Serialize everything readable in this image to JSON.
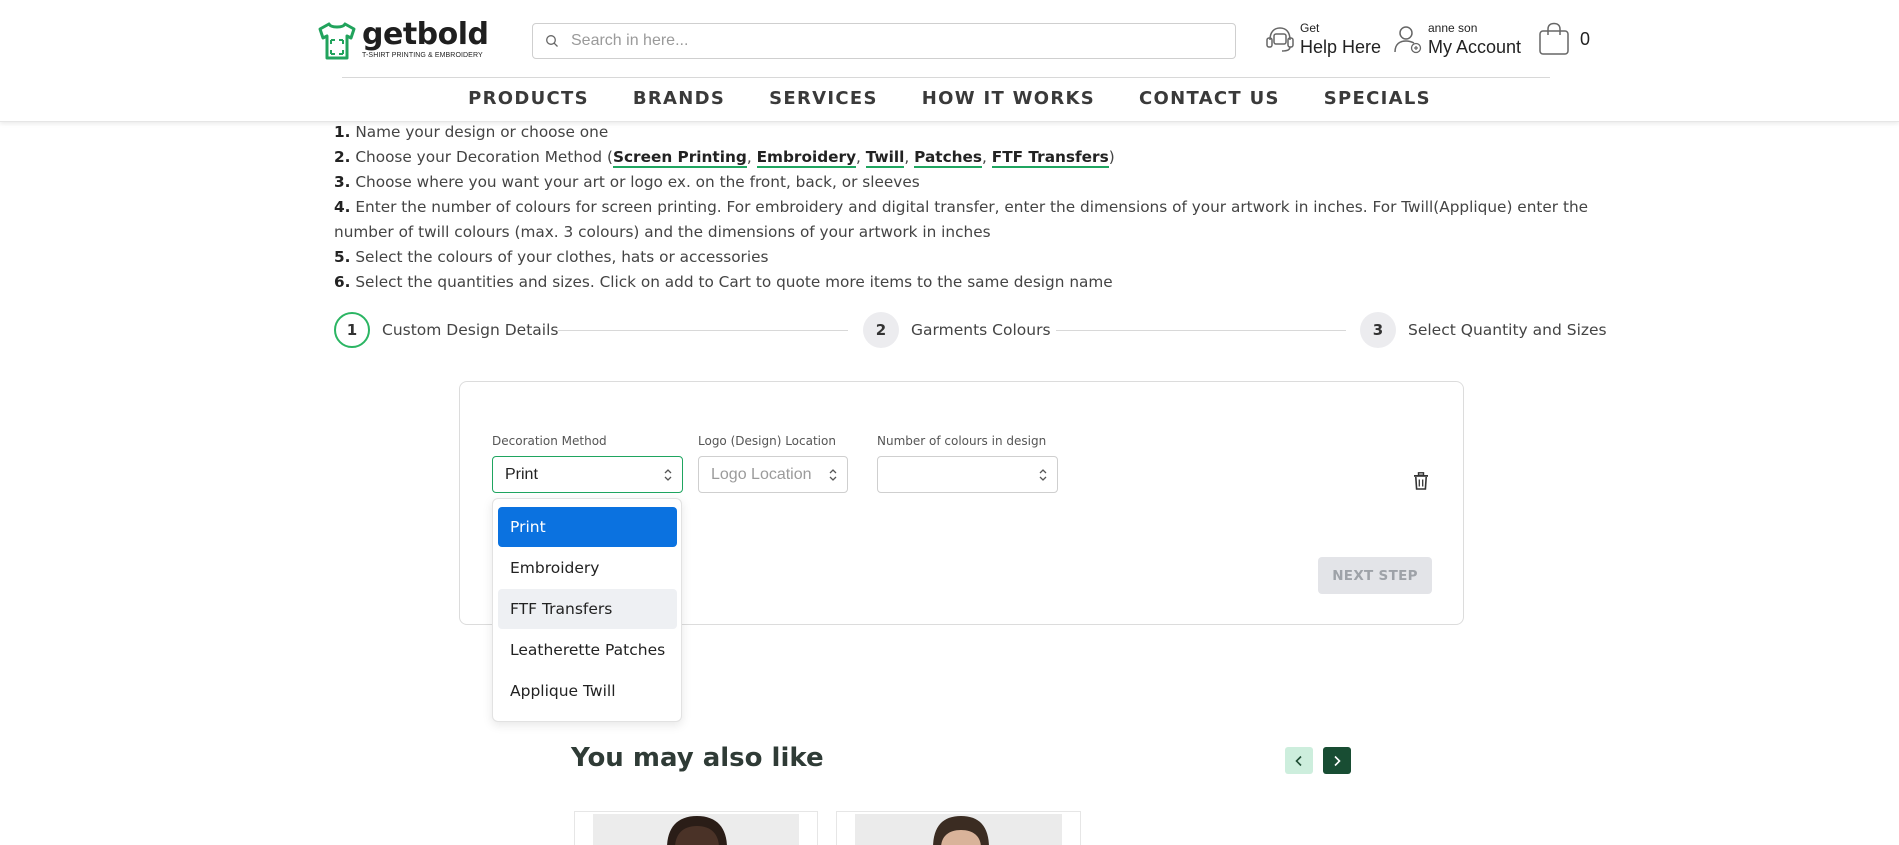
{
  "header": {
    "logo_word": "getbold",
    "logo_tagline": "T-SHIRT PRINTING & EMBROIDERY",
    "search_placeholder": "Search in here...",
    "help_small": "Get",
    "help_big": "Help Here",
    "account_small": "anne son",
    "account_big": "My Account",
    "cart_count": "0"
  },
  "nav": [
    "PRODUCTS",
    "BRANDS",
    "SERVICES",
    "HOW IT WORKS",
    "CONTACT US",
    "SPECIALS"
  ],
  "instructions": {
    "n1": "1.",
    "t1": "Name your design or choose one",
    "n2": "2.",
    "t2a": "Choose your Decoration Method (",
    "m1": "Screen Printing",
    "m2": "Embroidery",
    "m3": "Twill",
    "m4": "Patches",
    "m5": "FTF Transfers",
    "sep": ", ",
    "close": ")",
    "n3": "3.",
    "t3": "Choose where you want your art or logo ex. on the front, back, or sleeves",
    "n4": "4.",
    "t4": "Enter the number of colours for screen printing. For embroidery and digital transfer, enter the dimensions of your artwork in inches. For Twill(Applique) enter the number of twill colours (max. 3 colours) and the dimensions of your artwork in inches",
    "n5": "5.",
    "t5": "Select the colours of your clothes, hats or accessories",
    "n6": "6.",
    "t6": "Select the quantities and sizes. Click on add to Cart to quote more items to the same design name"
  },
  "stepper": [
    {
      "num": "1",
      "label": "Custom Design Details"
    },
    {
      "num": "2",
      "label": "Garments Colours"
    },
    {
      "num": "3",
      "label": "Select Quantity and Sizes"
    }
  ],
  "form": {
    "decoration_label": "Decoration Method",
    "decoration_value": "Print",
    "location_label": "Logo (Design) Location",
    "location_placeholder": "Logo Location",
    "colours_label": "Number of colours in design",
    "colours_value": "",
    "next_label": "NEXT STEP"
  },
  "dropdown_options": [
    "Print",
    "Embroidery",
    "FTF Transfers",
    "Leatherette Patches",
    "Applique Twill"
  ],
  "also_like": {
    "title": "You may also like"
  },
  "colors": {
    "accent_green": "#1fa560",
    "selected_blue": "#0b72e0",
    "dark_green": "#184d33",
    "light_green": "#cdeedd"
  }
}
